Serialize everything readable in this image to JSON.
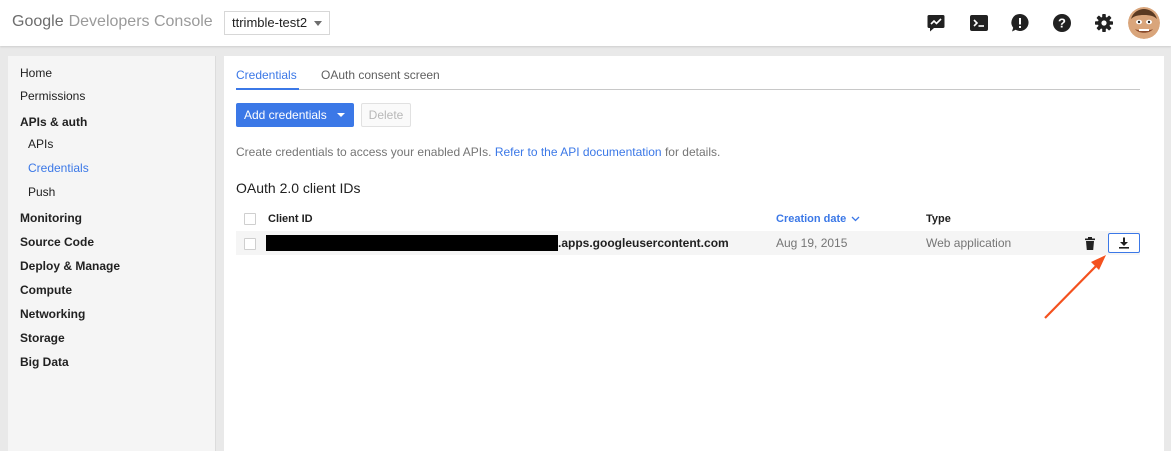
{
  "header": {
    "brand": "Google",
    "product": "Developers Console",
    "project": "ttrimble-test2",
    "icons": [
      "activity-icon",
      "cloud-shell-icon",
      "notifications-icon",
      "help-icon",
      "settings-icon",
      "avatar"
    ]
  },
  "sidebar": {
    "items": [
      {
        "label": "Home"
      },
      {
        "label": "Permissions"
      },
      {
        "label": "APIs & auth"
      },
      {
        "label": "APIs"
      },
      {
        "label": "Credentials"
      },
      {
        "label": "Push"
      },
      {
        "label": "Monitoring"
      },
      {
        "label": "Source Code"
      },
      {
        "label": "Deploy & Manage"
      },
      {
        "label": "Compute"
      },
      {
        "label": "Networking"
      },
      {
        "label": "Storage"
      },
      {
        "label": "Big Data"
      }
    ]
  },
  "main": {
    "tabs": [
      {
        "label": "Credentials",
        "active": true
      },
      {
        "label": "OAuth consent screen",
        "active": false
      }
    ],
    "add_button": "Add credentials",
    "delete_button": "Delete",
    "intro_text": "Create credentials to access your enabled APIs.",
    "intro_link": "Refer to the API documentation",
    "intro_suffix": "for details.",
    "section_title": "OAuth 2.0 client IDs",
    "table": {
      "columns": [
        "Client ID",
        "Creation date",
        "Type"
      ],
      "sorted_column": "Creation date",
      "rows": [
        {
          "client_id_suffix": ".apps.googleusercontent.com",
          "created": "Aug 19, 2015",
          "type": "Web application"
        }
      ]
    }
  },
  "colors": {
    "accent": "#3b78e7",
    "annotation_arrow": "#f4511e"
  }
}
